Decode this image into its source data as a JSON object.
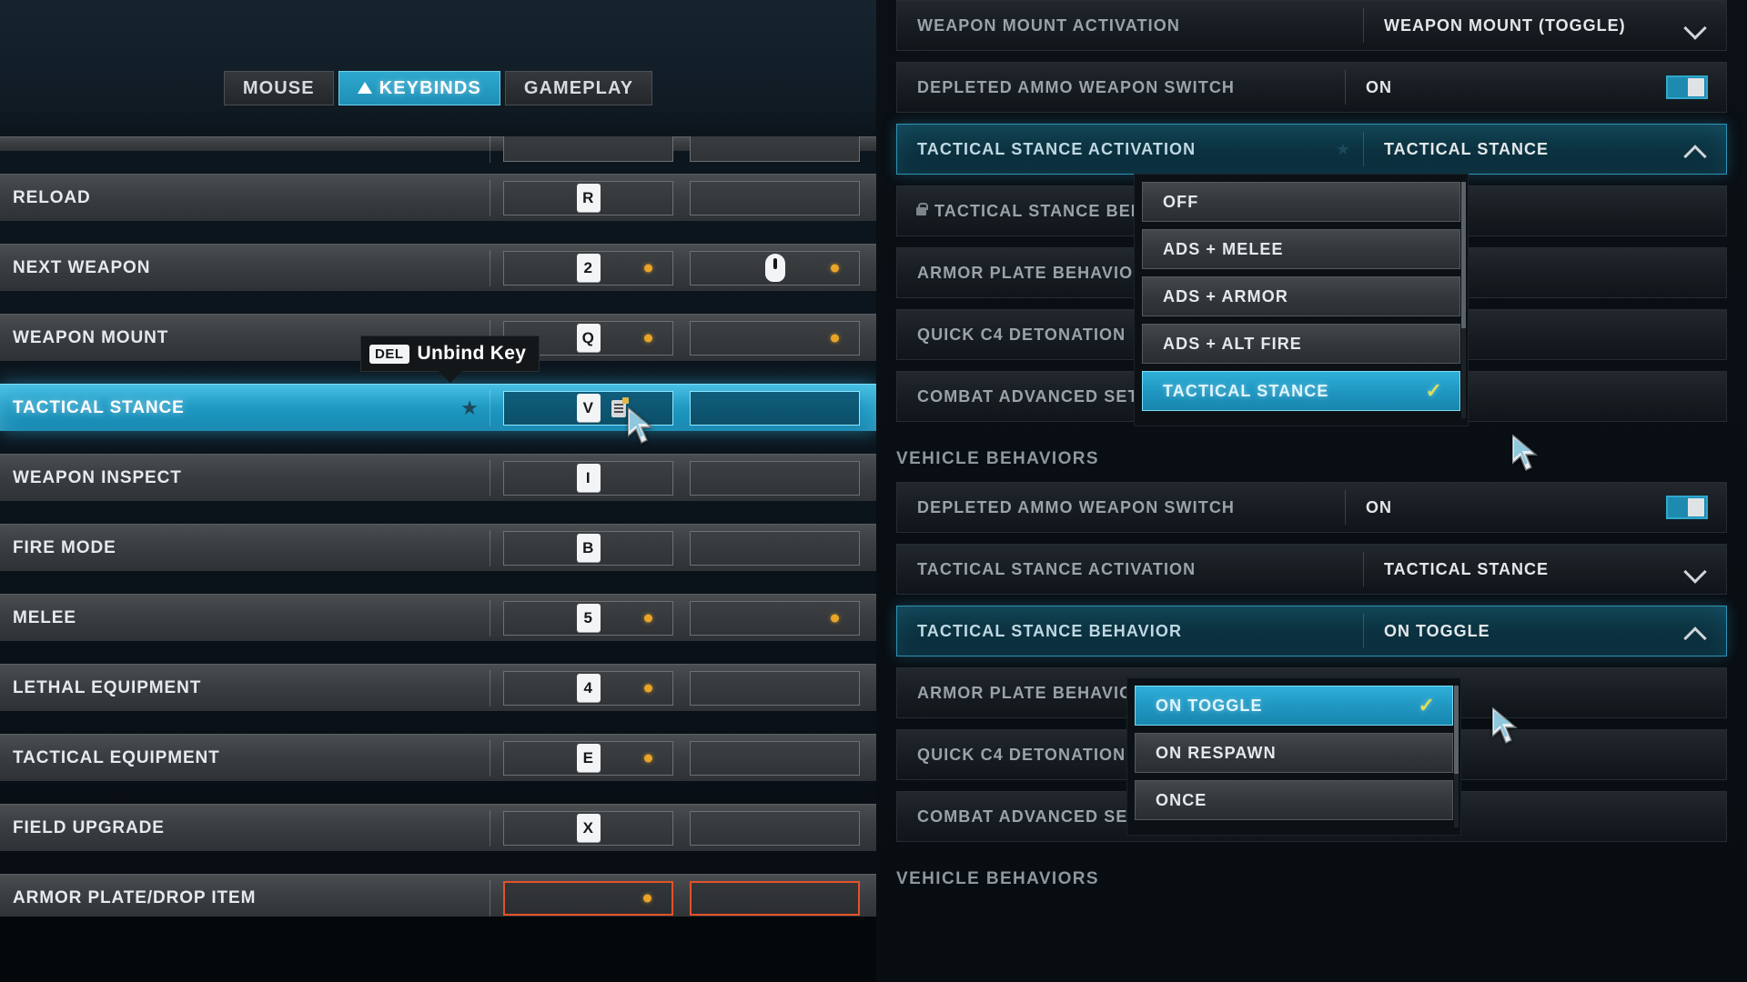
{
  "tabs": [
    {
      "label": "MOUSE",
      "active": false,
      "icon": ""
    },
    {
      "label": "KEYBINDS",
      "active": true,
      "icon": "warning-triangle-icon"
    },
    {
      "label": "GAMEPLAY",
      "active": false,
      "icon": ""
    }
  ],
  "tooltip": {
    "key": "DEL",
    "label": "Unbind Key"
  },
  "keybinds": [
    {
      "name": "RELOAD",
      "primary": "R",
      "primary_type": "key",
      "primary_dot": false,
      "secondary": "",
      "secondary_type": "empty",
      "secondary_dot": false,
      "selected": false,
      "alert": false
    },
    {
      "name": "NEXT WEAPON",
      "primary": "2",
      "primary_type": "key",
      "primary_dot": true,
      "secondary": "mouse-scroll-icon",
      "secondary_type": "mouse",
      "secondary_dot": true,
      "selected": false,
      "alert": false
    },
    {
      "name": "WEAPON MOUNT",
      "primary": "Q",
      "primary_type": "key",
      "primary_dot": true,
      "secondary": "",
      "secondary_type": "empty",
      "secondary_dot": true,
      "selected": false,
      "alert": false
    },
    {
      "name": "TACTICAL STANCE",
      "primary": "V",
      "primary_type": "key",
      "primary_dot": false,
      "secondary": "",
      "secondary_type": "empty",
      "secondary_dot": false,
      "selected": true,
      "alert": false,
      "starred": true,
      "note": true
    },
    {
      "name": "WEAPON INSPECT",
      "primary": "I",
      "primary_type": "key",
      "primary_dot": false,
      "secondary": "",
      "secondary_type": "empty",
      "secondary_dot": false,
      "selected": false,
      "alert": false
    },
    {
      "name": "FIRE MODE",
      "primary": "B",
      "primary_type": "key",
      "primary_dot": false,
      "secondary": "",
      "secondary_type": "empty",
      "secondary_dot": false,
      "selected": false,
      "alert": false
    },
    {
      "name": "MELEE",
      "primary": "5",
      "primary_type": "key",
      "primary_dot": true,
      "secondary": "",
      "secondary_type": "empty",
      "secondary_dot": true,
      "selected": false,
      "alert": false
    },
    {
      "name": "LETHAL EQUIPMENT",
      "primary": "4",
      "primary_type": "key",
      "primary_dot": true,
      "secondary": "",
      "secondary_type": "empty",
      "secondary_dot": false,
      "selected": false,
      "alert": false
    },
    {
      "name": "TACTICAL EQUIPMENT",
      "primary": "E",
      "primary_type": "key",
      "primary_dot": true,
      "secondary": "",
      "secondary_type": "empty",
      "secondary_dot": false,
      "selected": false,
      "alert": false
    },
    {
      "name": "FIELD UPGRADE",
      "primary": "X",
      "primary_type": "key",
      "primary_dot": false,
      "secondary": "",
      "secondary_type": "empty",
      "secondary_dot": false,
      "selected": false,
      "alert": false
    },
    {
      "name": "ARMOR PLATE/DROP ITEM",
      "primary": "",
      "primary_type": "empty",
      "primary_dot": true,
      "secondary": "",
      "secondary_type": "empty",
      "secondary_dot": false,
      "selected": false,
      "alert": true
    }
  ],
  "settings_top": [
    {
      "label": "WEAPON MOUNT ACTIVATION",
      "value": "WEAPON MOUNT (TOGGLE)",
      "control": "chevron-down",
      "highlight": false
    },
    {
      "label": "DEPLETED AMMO WEAPON SWITCH",
      "value": "ON",
      "control": "toggle-on",
      "highlight": false
    },
    {
      "label": "TACTICAL STANCE ACTIVATION",
      "value": "TACTICAL STANCE",
      "control": "chevron-up",
      "highlight": true,
      "starred": true
    },
    {
      "label": "TACTICAL STANCE BEHAVIOR",
      "value": "",
      "control": "none",
      "highlight": false,
      "locked": true
    },
    {
      "label": "ARMOR PLATE BEHAVIOR",
      "value": "",
      "control": "none",
      "highlight": false
    },
    {
      "label": "QUICK C4 DETONATION",
      "value": "",
      "control": "none",
      "highlight": false
    },
    {
      "label": "COMBAT ADVANCED SETTINGS",
      "value": "",
      "control": "none",
      "highlight": false
    }
  ],
  "section_heading_top": "VEHICLE BEHAVIORS",
  "settings_bottom": [
    {
      "label": "DEPLETED AMMO WEAPON SWITCH",
      "value": "ON",
      "control": "toggle-on",
      "highlight": false
    },
    {
      "label": "TACTICAL STANCE ACTIVATION",
      "value": "TACTICAL STANCE",
      "control": "chevron-down",
      "highlight": false
    },
    {
      "label": "TACTICAL STANCE BEHAVIOR",
      "value": "ON TOGGLE",
      "control": "chevron-up",
      "highlight": true
    },
    {
      "label": "ARMOR PLATE BEHAVIOR",
      "value": "",
      "control": "none",
      "highlight": false
    },
    {
      "label": "QUICK C4 DETONATION",
      "value": "",
      "control": "none",
      "highlight": false
    },
    {
      "label": "COMBAT ADVANCED SETTINGS",
      "value": "",
      "control": "none",
      "highlight": false
    }
  ],
  "section_heading_bottom": "VEHICLE BEHAVIORS",
  "dropdown_activation": {
    "options": [
      {
        "label": "OFF",
        "selected": false
      },
      {
        "label": "ADS + MELEE",
        "selected": false
      },
      {
        "label": "ADS + ARMOR",
        "selected": false
      },
      {
        "label": "ADS + ALT FIRE",
        "selected": false
      },
      {
        "label": "TACTICAL STANCE",
        "selected": true
      }
    ]
  },
  "dropdown_behavior": {
    "options": [
      {
        "label": "ON TOGGLE",
        "selected": true
      },
      {
        "label": "ON RESPAWN",
        "selected": false
      },
      {
        "label": "ONCE",
        "selected": false
      }
    ]
  },
  "colors": {
    "accent": "#2fb0d8",
    "accent_dark": "#1887ae",
    "warn_orange": "#e2522a",
    "dot_orange": "#eaa427",
    "check_yellow": "#d9e05a"
  }
}
